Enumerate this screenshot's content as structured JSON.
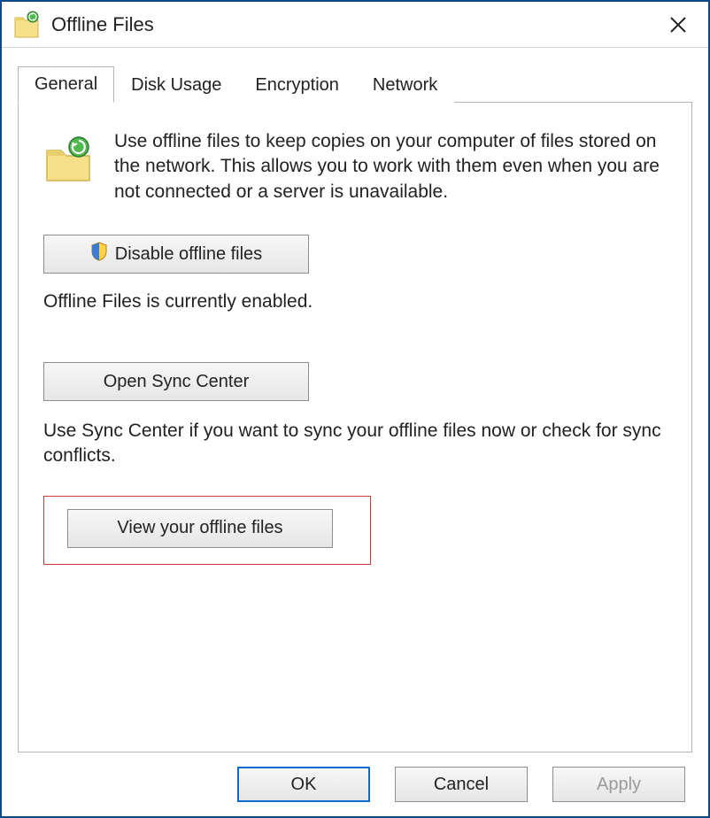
{
  "window": {
    "title": "Offline Files"
  },
  "tabs": [
    {
      "label": "General",
      "active": true
    },
    {
      "label": "Disk Usage",
      "active": false
    },
    {
      "label": "Encryption",
      "active": false
    },
    {
      "label": "Network",
      "active": false
    }
  ],
  "general": {
    "intro": "Use offline files to keep copies on your computer of files stored on the network.  This allows you to work with them even when you are not connected or a server is unavailable.",
    "disable_button": "Disable offline files",
    "status": "Offline Files is currently enabled.",
    "open_sync_button": "Open Sync Center",
    "sync_desc": "Use Sync Center if you want to sync your offline files now or check for sync conflicts.",
    "view_button": "View your offline files"
  },
  "footer": {
    "ok": "OK",
    "cancel": "Cancel",
    "apply": "Apply"
  }
}
